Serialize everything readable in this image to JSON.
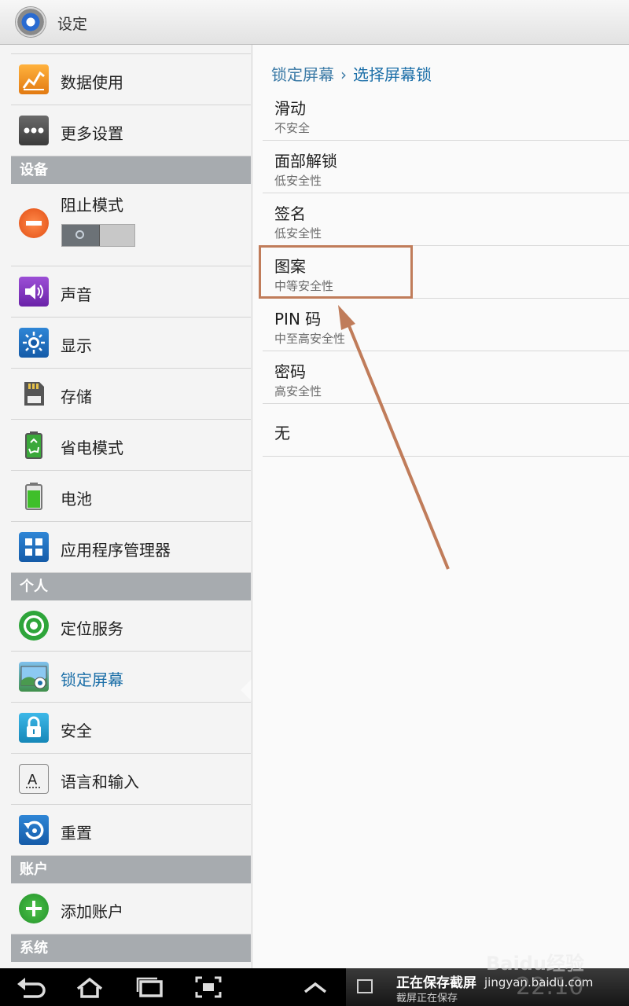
{
  "app": {
    "title": "设定"
  },
  "sidebar": {
    "items_a": [
      {
        "label": "数据使用",
        "icon": "data-usage-icon"
      },
      {
        "label": "更多设置",
        "icon": "more-settings-icon"
      }
    ],
    "header_device": "设备",
    "block_mode": {
      "label": "阻止模式",
      "icon": "block-mode-icon",
      "toggle_on": false
    },
    "items_b": [
      {
        "label": "声音",
        "icon": "sound-icon"
      },
      {
        "label": "显示",
        "icon": "display-icon"
      },
      {
        "label": "存储",
        "icon": "storage-icon"
      },
      {
        "label": "省电模式",
        "icon": "power-saving-icon"
      },
      {
        "label": "电池",
        "icon": "battery-icon"
      },
      {
        "label": "应用程序管理器",
        "icon": "app-manager-icon"
      }
    ],
    "header_personal": "个人",
    "items_c": [
      {
        "label": "定位服务",
        "icon": "location-icon"
      },
      {
        "label": "锁定屏幕",
        "icon": "lock-screen-icon",
        "active": true
      },
      {
        "label": "安全",
        "icon": "security-icon"
      },
      {
        "label": "语言和输入",
        "icon": "language-icon"
      },
      {
        "label": "重置",
        "icon": "reset-icon"
      }
    ],
    "header_accounts": "账户",
    "items_d": [
      {
        "label": "添加账户",
        "icon": "add-account-icon"
      }
    ],
    "header_system": "系统"
  },
  "breadcrumb": {
    "parent": "锁定屏幕",
    "separator": "›",
    "current": "选择屏幕锁"
  },
  "options": [
    {
      "title": "滑动",
      "subtitle": "不安全"
    },
    {
      "title": "面部解锁",
      "subtitle": "低安全性"
    },
    {
      "title": "签名",
      "subtitle": "低安全性"
    },
    {
      "title": "图案",
      "subtitle": "中等安全性",
      "highlighted": true
    },
    {
      "title": "PIN 码",
      "subtitle": "中至高安全性"
    },
    {
      "title": "密码",
      "subtitle": "高安全性"
    },
    {
      "title": "无",
      "subtitle": ""
    }
  ],
  "notification": {
    "title": "正在保存截屏",
    "subtitle": "截屏正在保存",
    "clock": "22:10"
  },
  "watermark": {
    "brand": "Baidu经验",
    "url": "jingyan.baidu.com"
  },
  "colors": {
    "accent": "#1c6fa8",
    "annotation": "#c07c5a",
    "section_header": "#a7abaf"
  }
}
